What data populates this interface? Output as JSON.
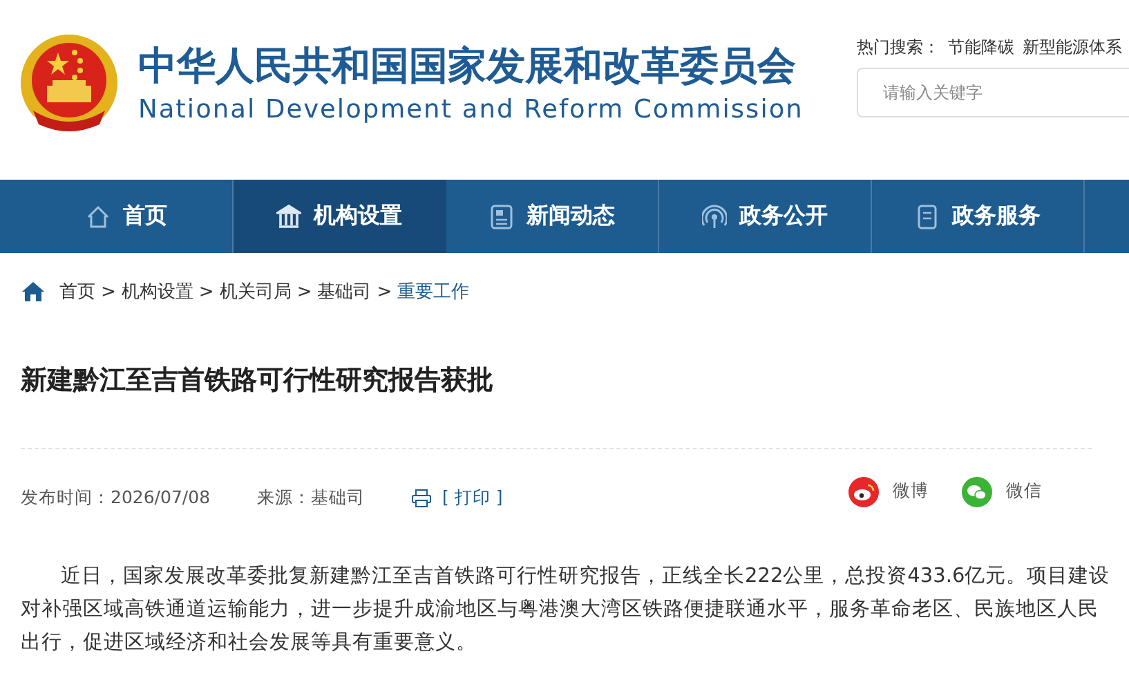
{
  "header": {
    "title_cn": "中华人民共和国国家发展和改革委员会",
    "title_en": "National Development and Reform Commission",
    "hot_search": {
      "label": "热门搜索：",
      "terms": [
        "节能降碳",
        "新型能源体系"
      ]
    },
    "search": {
      "placeholder": "请输入关键字"
    }
  },
  "nav": [
    {
      "label": "首页",
      "kind": "home",
      "selected": false
    },
    {
      "label": "机构设置",
      "kind": "building",
      "selected": true
    },
    {
      "label": "新闻动态",
      "kind": "news",
      "selected": false
    },
    {
      "label": "政务公开",
      "kind": "signal",
      "selected": false
    },
    {
      "label": "政务服务",
      "kind": "doc",
      "selected": false
    }
  ],
  "breadcrumb": {
    "items": [
      {
        "label": "首页",
        "current": false
      },
      {
        "label": "机构设置",
        "current": false
      },
      {
        "label": "机关司局",
        "current": false
      },
      {
        "label": "基础司",
        "current": false
      },
      {
        "label": "重要工作",
        "current": true
      }
    ],
    "separators": [
      ">",
      ">",
      ">",
      ">"
    ]
  },
  "article": {
    "title": "新建黔江至吉首铁路可行性研究报告获批",
    "date": "发布时间：2026/07/08",
    "source": "来源：基础司",
    "print": "[ 打印 ]",
    "share": [
      {
        "kind": "weibo",
        "label": "微博"
      },
      {
        "kind": "wechat",
        "label": "微信"
      }
    ],
    "body": "近日，国家发展改革委批复新建黔江至吉首铁路可行性研究报告，正线全长222公里，总投资433.6亿元。项目建设对补强区域高铁通道运输能力，进一步提升成渝地区与粤港澳大湾区铁路便捷联通水平，服务革命老区、民族地区人民出行，促进区域经济和社会发展等具有重要意义。"
  }
}
